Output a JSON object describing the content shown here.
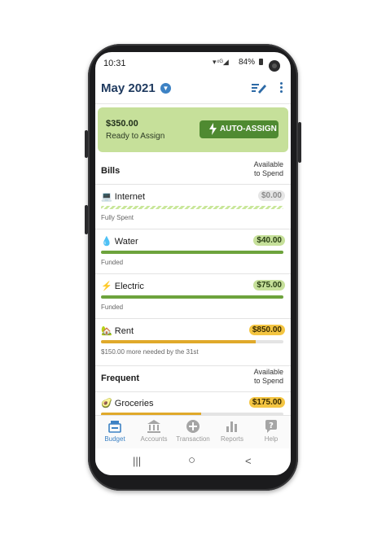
{
  "status": {
    "time": "10:31",
    "battery": "84%",
    "signal_icons": "wifi signal"
  },
  "header": {
    "month": "May 2021"
  },
  "ready": {
    "amount": "$350.00",
    "label": "Ready to Assign",
    "button": "AUTO-ASSIGN"
  },
  "groups": [
    {
      "name": "Bills",
      "available": [
        "Available",
        "to Spend"
      ]
    },
    {
      "name": "Frequent",
      "available": [
        "Available",
        "to Spend"
      ]
    }
  ],
  "categories": [
    {
      "emoji": "💻",
      "name": "Internet",
      "amount": "$0.00",
      "status": "Fully Spent",
      "progress": 1.0,
      "pill_color": "#e6e6e6",
      "pill_text_color": "#8a8a8a",
      "bar_style": "hatched"
    },
    {
      "emoji": "💧",
      "name": "Water",
      "amount": "$40.00",
      "status": "Funded",
      "progress": 1.0,
      "pill_color": "#c6e09a",
      "pill_text_color": "#2a3f15",
      "bar_color": "#6da33c"
    },
    {
      "emoji": "⚡",
      "name": "Electric",
      "amount": "$75.00",
      "status": "Funded",
      "progress": 1.0,
      "pill_color": "#c6e09a",
      "pill_text_color": "#2a3f15",
      "bar_color": "#6da33c"
    },
    {
      "emoji": "🏡",
      "name": "Rent",
      "amount": "$850.00",
      "status": "$150.00 more needed by the 31st",
      "progress": 0.85,
      "pill_color": "#f4c542",
      "pill_text_color": "#3a2c00",
      "bar_color": "#e0a92a"
    },
    {
      "emoji": "🥑",
      "name": "Groceries",
      "amount": "$175.00",
      "status": "",
      "progress": 0.55,
      "pill_color": "#f4c542",
      "pill_text_color": "#3a2c00",
      "bar_color": "#e0a92a"
    }
  ],
  "tabs": [
    {
      "label": "Budget",
      "icon": "budget-icon",
      "active": true
    },
    {
      "label": "Accounts",
      "icon": "bank-icon",
      "active": false
    },
    {
      "label": "Transaction",
      "icon": "plus-circle-icon",
      "active": false
    },
    {
      "label": "Reports",
      "icon": "bar-chart-icon",
      "active": false
    },
    {
      "label": "Help",
      "icon": "help-icon",
      "active": false
    }
  ],
  "navbar": {
    "recents": "|||",
    "home": "○",
    "back": "<"
  },
  "colors": {
    "accent": "#3d82c4",
    "title": "#1f3a5f",
    "ready_bg": "#c6e09a",
    "button_green": "#4f8a31"
  }
}
